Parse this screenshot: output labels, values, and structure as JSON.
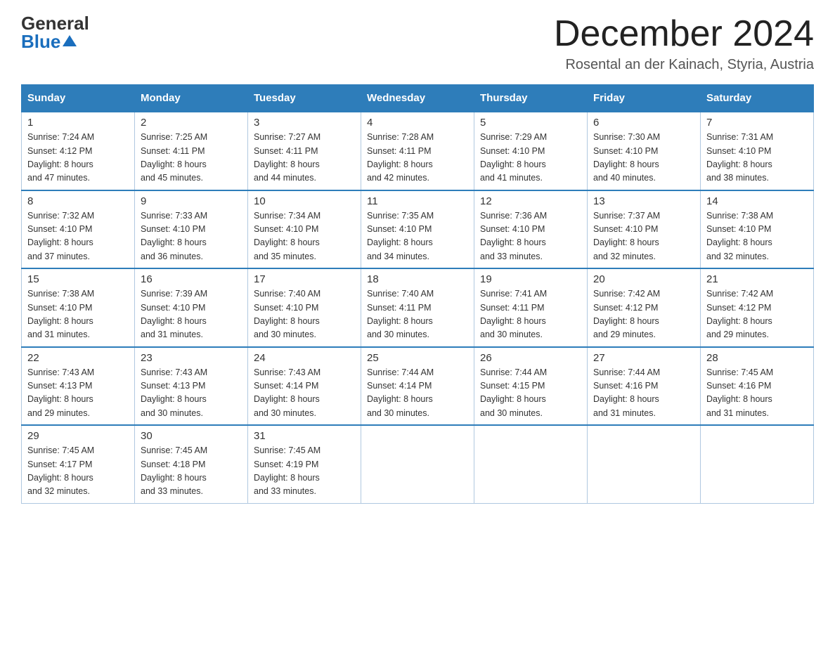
{
  "logo": {
    "general": "General",
    "blue": "Blue"
  },
  "title": "December 2024",
  "subtitle": "Rosental an der Kainach, Styria, Austria",
  "days_of_week": [
    "Sunday",
    "Monday",
    "Tuesday",
    "Wednesday",
    "Thursday",
    "Friday",
    "Saturday"
  ],
  "weeks": [
    [
      {
        "day": "1",
        "sunrise": "7:24 AM",
        "sunset": "4:12 PM",
        "daylight": "8 hours and 47 minutes."
      },
      {
        "day": "2",
        "sunrise": "7:25 AM",
        "sunset": "4:11 PM",
        "daylight": "8 hours and 45 minutes."
      },
      {
        "day": "3",
        "sunrise": "7:27 AM",
        "sunset": "4:11 PM",
        "daylight": "8 hours and 44 minutes."
      },
      {
        "day": "4",
        "sunrise": "7:28 AM",
        "sunset": "4:11 PM",
        "daylight": "8 hours and 42 minutes."
      },
      {
        "day": "5",
        "sunrise": "7:29 AM",
        "sunset": "4:10 PM",
        "daylight": "8 hours and 41 minutes."
      },
      {
        "day": "6",
        "sunrise": "7:30 AM",
        "sunset": "4:10 PM",
        "daylight": "8 hours and 40 minutes."
      },
      {
        "day": "7",
        "sunrise": "7:31 AM",
        "sunset": "4:10 PM",
        "daylight": "8 hours and 38 minutes."
      }
    ],
    [
      {
        "day": "8",
        "sunrise": "7:32 AM",
        "sunset": "4:10 PM",
        "daylight": "8 hours and 37 minutes."
      },
      {
        "day": "9",
        "sunrise": "7:33 AM",
        "sunset": "4:10 PM",
        "daylight": "8 hours and 36 minutes."
      },
      {
        "day": "10",
        "sunrise": "7:34 AM",
        "sunset": "4:10 PM",
        "daylight": "8 hours and 35 minutes."
      },
      {
        "day": "11",
        "sunrise": "7:35 AM",
        "sunset": "4:10 PM",
        "daylight": "8 hours and 34 minutes."
      },
      {
        "day": "12",
        "sunrise": "7:36 AM",
        "sunset": "4:10 PM",
        "daylight": "8 hours and 33 minutes."
      },
      {
        "day": "13",
        "sunrise": "7:37 AM",
        "sunset": "4:10 PM",
        "daylight": "8 hours and 32 minutes."
      },
      {
        "day": "14",
        "sunrise": "7:38 AM",
        "sunset": "4:10 PM",
        "daylight": "8 hours and 32 minutes."
      }
    ],
    [
      {
        "day": "15",
        "sunrise": "7:38 AM",
        "sunset": "4:10 PM",
        "daylight": "8 hours and 31 minutes."
      },
      {
        "day": "16",
        "sunrise": "7:39 AM",
        "sunset": "4:10 PM",
        "daylight": "8 hours and 31 minutes."
      },
      {
        "day": "17",
        "sunrise": "7:40 AM",
        "sunset": "4:10 PM",
        "daylight": "8 hours and 30 minutes."
      },
      {
        "day": "18",
        "sunrise": "7:40 AM",
        "sunset": "4:11 PM",
        "daylight": "8 hours and 30 minutes."
      },
      {
        "day": "19",
        "sunrise": "7:41 AM",
        "sunset": "4:11 PM",
        "daylight": "8 hours and 30 minutes."
      },
      {
        "day": "20",
        "sunrise": "7:42 AM",
        "sunset": "4:12 PM",
        "daylight": "8 hours and 29 minutes."
      },
      {
        "day": "21",
        "sunrise": "7:42 AM",
        "sunset": "4:12 PM",
        "daylight": "8 hours and 29 minutes."
      }
    ],
    [
      {
        "day": "22",
        "sunrise": "7:43 AM",
        "sunset": "4:13 PM",
        "daylight": "8 hours and 29 minutes."
      },
      {
        "day": "23",
        "sunrise": "7:43 AM",
        "sunset": "4:13 PM",
        "daylight": "8 hours and 30 minutes."
      },
      {
        "day": "24",
        "sunrise": "7:43 AM",
        "sunset": "4:14 PM",
        "daylight": "8 hours and 30 minutes."
      },
      {
        "day": "25",
        "sunrise": "7:44 AM",
        "sunset": "4:14 PM",
        "daylight": "8 hours and 30 minutes."
      },
      {
        "day": "26",
        "sunrise": "7:44 AM",
        "sunset": "4:15 PM",
        "daylight": "8 hours and 30 minutes."
      },
      {
        "day": "27",
        "sunrise": "7:44 AM",
        "sunset": "4:16 PM",
        "daylight": "8 hours and 31 minutes."
      },
      {
        "day": "28",
        "sunrise": "7:45 AM",
        "sunset": "4:16 PM",
        "daylight": "8 hours and 31 minutes."
      }
    ],
    [
      {
        "day": "29",
        "sunrise": "7:45 AM",
        "sunset": "4:17 PM",
        "daylight": "8 hours and 32 minutes."
      },
      {
        "day": "30",
        "sunrise": "7:45 AM",
        "sunset": "4:18 PM",
        "daylight": "8 hours and 33 minutes."
      },
      {
        "day": "31",
        "sunrise": "7:45 AM",
        "sunset": "4:19 PM",
        "daylight": "8 hours and 33 minutes."
      },
      null,
      null,
      null,
      null
    ]
  ],
  "labels": {
    "sunrise": "Sunrise:",
    "sunset": "Sunset:",
    "daylight": "Daylight:"
  },
  "colors": {
    "header_bg": "#2e7dba",
    "border": "#b0c8e0"
  }
}
